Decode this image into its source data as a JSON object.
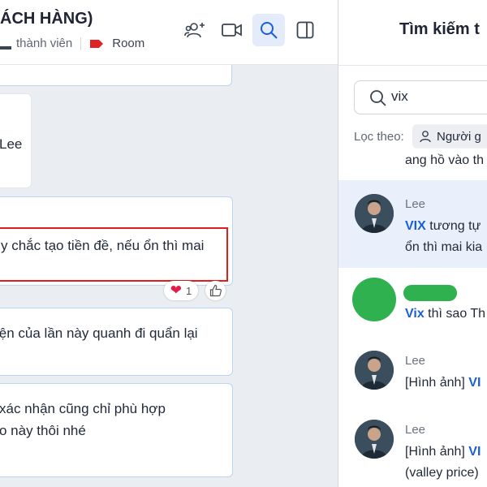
{
  "header": {
    "title": "ÁCH HÀNG)",
    "members_label": "thành viên",
    "tag_label": "Room",
    "tag_color": "#e02424",
    "icons": [
      "add-group-icon",
      "video-call-icon",
      "search-icon",
      "toggle-panel-icon"
    ]
  },
  "chat": {
    "messages": [
      {
        "text": "Lee"
      },
      {
        "text": "y chắc tạo tiền đề, nếu ổn thì mai",
        "reaction_count": "1"
      },
      {
        "text": "iện của lần này quanh đi quẩn lại"
      },
      {
        "line1": "xác nhận cũng chỉ phù hợp",
        "line2": "o này thôi nhé"
      }
    ]
  },
  "panel": {
    "title": "Tìm kiếm t",
    "search_value": "vix",
    "filter_label": "Lọc theo:",
    "filter_chip": "Người g",
    "results": [
      {
        "text": "ang hồ vào th"
      },
      {
        "name": "Lee",
        "keyword": "VIX",
        "text": " tương tự",
        "line2": "ổn thì mai kia"
      },
      {
        "keyword": "Vix",
        "text": " thì sao Th"
      },
      {
        "name": "Lee",
        "prefix": "[Hình ảnh] ",
        "keyword": "VI"
      },
      {
        "name": "Lee",
        "prefix": "[Hình ảnh] ",
        "keyword": "VI",
        "line2": "(valley price)"
      }
    ]
  }
}
